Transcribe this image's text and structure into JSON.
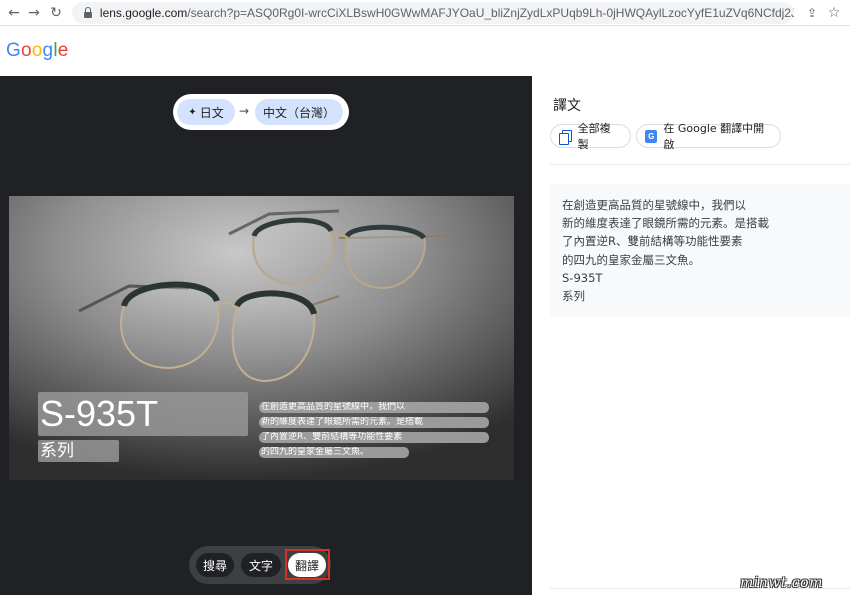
{
  "browser": {
    "url_host": "lens.google.com",
    "url_path": "/search?p=ASQ0Rg0I-wrcCiXLBswH0GWwMAFJYOaU_bliZnjZydLxPUqb9Lh-0jHWQAylLzocYyfE1uZVq6NCfdj2JkpAnzGQ...",
    "icons": [
      "back-icon",
      "forward-icon",
      "reload-icon",
      "lock-icon",
      "share-icon",
      "bookmark-star-icon"
    ]
  },
  "header": {
    "logo": [
      "G",
      "o",
      "o",
      "g",
      "l",
      "e"
    ],
    "logo_colors": [
      "#4285f4",
      "#ea4335",
      "#fbbc05",
      "#4285f4",
      "#34a853",
      "#ea4335"
    ]
  },
  "lens": {
    "source_language": "日文",
    "target_language": "中文（台灣）",
    "overlay": {
      "title": "S-935T",
      "subtitle": "系列",
      "lines": [
        "在創造更高品質的星號線中，我們以",
        "新的維度表達了眼鏡所需的元素。是搭載",
        "了內置逆R、雙前結構等功能性要素",
        "的四九的皇家金屬三文魚。"
      ]
    },
    "modes": {
      "search": "搜尋",
      "text": "文字",
      "translate": "翻譯"
    }
  },
  "translation_panel": {
    "title": "譯文",
    "copy_all": "全部複製",
    "open_in_translate": "在 Google 翻譯中開啟",
    "result_lines": [
      "在創造更高品質的星號線中，我們以",
      "新的維度表達了眼鏡所需的元素。是搭載",
      "了內置逆R、雙前結構等功能性要素",
      "的四九的皇家金屬三文魚。",
      "S-935T",
      "系列"
    ]
  },
  "watermark": "minwt.com"
}
